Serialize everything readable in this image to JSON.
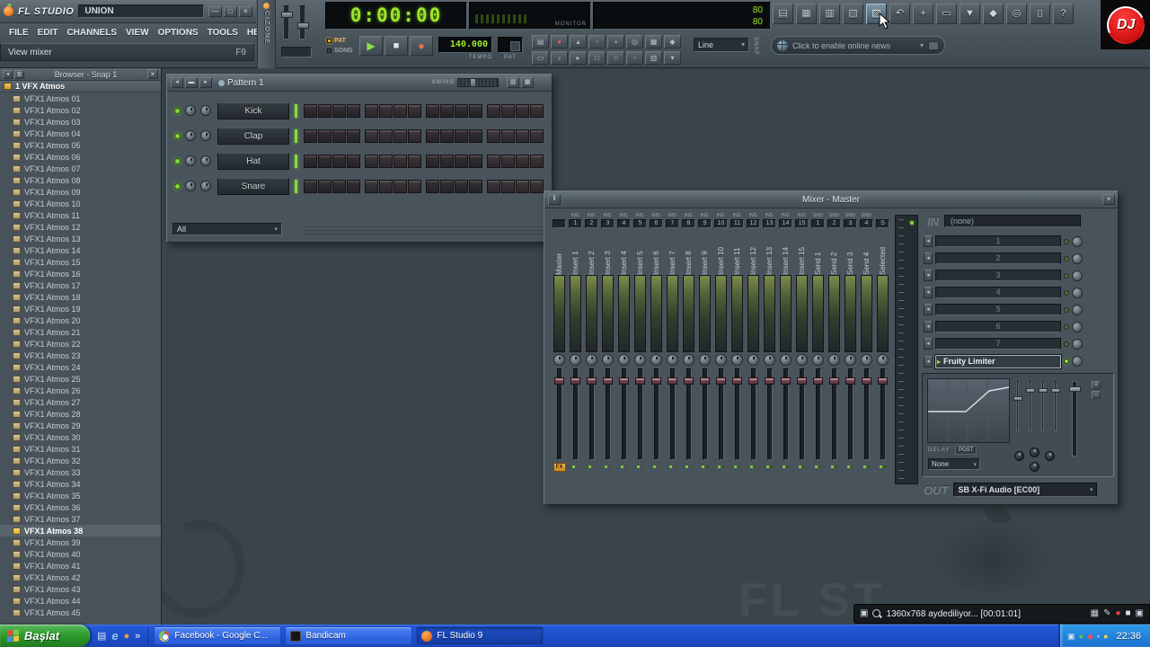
{
  "colors": {
    "lcd_green": "#9de428",
    "desktop": "#3a444b",
    "panel": "#4b565e",
    "taskbar_blue": "#1e4ec8",
    "start_green": "#2f9e2f",
    "record_red": "#e84c40",
    "fx_orange": "#d8942a",
    "dj_red": "#d91616",
    "step_dark": "#332f33",
    "selection": "#ffffff"
  },
  "titlebar": {
    "app": "FL STUDIO",
    "edition": "UNION",
    "window_buttons": [
      {
        "name": "minimize-button",
        "glyph": "—"
      },
      {
        "name": "maximize-button",
        "glyph": "□"
      },
      {
        "name": "close-button",
        "glyph": "×"
      }
    ]
  },
  "menu": {
    "items": [
      "FILE",
      "EDIT",
      "CHANNELS",
      "VIEW",
      "OPTIONS",
      "TOOLS",
      "HELP"
    ]
  },
  "hint": {
    "text": "View mixer",
    "key": "F9"
  },
  "cizone": {
    "label": "CIZONE"
  },
  "transport": {
    "time": "0:00:00",
    "pat_label": "PAT",
    "song_label": "SONG",
    "tempo": "140.000",
    "tempo_label": "TEMPO",
    "pat_lcd_label": "PAT",
    "play_glyph": "▶",
    "stop_glyph": "■",
    "rec_glyph": "●"
  },
  "panels": {
    "monitor_label": "MONITOR",
    "values": [
      "80",
      "80"
    ]
  },
  "mini_row1": [
    {
      "name": "typing-keyboard-icon",
      "glyph": "▤"
    },
    {
      "name": "countdown-icon",
      "glyph": "●",
      "color": "#e06050"
    },
    {
      "name": "metronome-icon",
      "glyph": "▴"
    },
    {
      "name": "wait-input-icon",
      "glyph": "◦"
    },
    {
      "name": "blend-record-icon",
      "glyph": "▪"
    },
    {
      "name": "loop-record-icon",
      "glyph": "◎"
    },
    {
      "name": "step-edit-icon",
      "glyph": "▦"
    },
    {
      "name": "multilink-icon",
      "glyph": "◆"
    }
  ],
  "mini_row2": [
    {
      "name": "overdub-icon",
      "glyph": "▭"
    },
    {
      "name": "note-icon",
      "glyph": "♪"
    },
    {
      "name": "slide-icon",
      "glyph": "▸"
    },
    {
      "name": "mute-icon",
      "glyph": "□"
    },
    {
      "name": "solo-icon",
      "glyph": "○"
    },
    {
      "name": "marker-icon",
      "glyph": "▫"
    },
    {
      "name": "grid-icon",
      "glyph": "▥"
    },
    {
      "name": "menu-icon",
      "glyph": "▾"
    }
  ],
  "snap": {
    "value": "Line",
    "label": "SNAP"
  },
  "news": {
    "text": "Click to enable online news"
  },
  "top_buttons": [
    {
      "name": "playlist-button",
      "glyph": "▤"
    },
    {
      "name": "step-sequencer-button",
      "glyph": "▦"
    },
    {
      "name": "piano-roll-button",
      "glyph": "▥"
    },
    {
      "name": "browser-toggle-button",
      "glyph": "▧"
    },
    {
      "name": "mixer-toggle-button",
      "glyph": "▨",
      "active": true
    },
    {
      "name": "undo-button",
      "glyph": "↶"
    },
    {
      "name": "add-channel-button",
      "glyph": "+"
    },
    {
      "name": "open-button",
      "glyph": "▭"
    },
    {
      "name": "save-button",
      "glyph": "▼"
    },
    {
      "name": "tools-button",
      "glyph": "◆"
    },
    {
      "name": "find-button",
      "glyph": "◎"
    },
    {
      "name": "export-button",
      "glyph": "▯"
    },
    {
      "name": "help-button",
      "glyph": "?"
    }
  ],
  "dj": {
    "text": "DJ"
  },
  "watermark": {
    "text": "FL ST"
  },
  "browser": {
    "title": "Browser - Snap 1",
    "close_glyph": "×",
    "root": "1 VFX Atmos",
    "selected_index": 37,
    "header_icons": [
      {
        "name": "browser-back-icon",
        "glyph": "◂"
      },
      {
        "name": "browser-view-icon",
        "glyph": "▥"
      }
    ],
    "items": [
      "VFX1 Atmos 01",
      "VFX1 Atmos 02",
      "VFX1 Atmos 03",
      "VFX1 Atmos 04",
      "VFX1 Atmos 05",
      "VFX1 Atmos 06",
      "VFX1 Atmos 07",
      "VFX1 Atmos 08",
      "VFX1 Atmos 09",
      "VFX1 Atmos 10",
      "VFX1 Atmos 11",
      "VFX1 Atmos 12",
      "VFX1 Atmos 13",
      "VFX1 Atmos 14",
      "VFX1 Atmos 15",
      "VFX1 Atmos 16",
      "VFX1 Atmos 17",
      "VFX1 Atmos 18",
      "VFX1 Atmos 19",
      "VFX1 Atmos 20",
      "VFX1 Atmos 21",
      "VFX1 Atmos 22",
      "VFX1 Atmos 23",
      "VFX1 Atmos 24",
      "VFX1 Atmos 25",
      "VFX1 Atmos 26",
      "VFX1 Atmos 27",
      "VFX1 Atmos 28",
      "VFX1 Atmos 29",
      "VFX1 Atmos 30",
      "VFX1 Atmos 31",
      "VFX1 Atmos 32",
      "VFX1 Atmos 33",
      "VFX1 Atmos 34",
      "VFX1 Atmos 35",
      "VFX1 Atmos 36",
      "VFX1 Atmos 37",
      "VFX1 Atmos 38",
      "VFX1 Atmos 39",
      "VFX1 Atmos 40",
      "VFX1 Atmos 41",
      "VFX1 Atmos 42",
      "VFX1 Atmos 43",
      "VFX1 Atmos 44",
      "VFX1 Atmos 45"
    ]
  },
  "pattern": {
    "title": "Pattern 1",
    "swing_label": "SWING",
    "filter": "All",
    "steps": 16,
    "nav_buttons": [
      {
        "name": "prev-pattern-button",
        "glyph": "◂"
      },
      {
        "name": "pattern-menu-button",
        "glyph": "▬"
      },
      {
        "name": "next-pattern-button",
        "glyph": "▸"
      }
    ],
    "view_buttons": [
      {
        "name": "graph-editor-button",
        "glyph": "▥"
      },
      {
        "name": "keyboard-editor-button",
        "glyph": "▦"
      }
    ],
    "channels": [
      "Kick",
      "Clap",
      "Hat",
      "Snare"
    ]
  },
  "mixer": {
    "title": "Mixer - Master",
    "close_glyph": "×",
    "corner_glyph": "‖",
    "fx_label": "FX",
    "tracks": [
      {
        "t": "",
        "n": "",
        "name": "Master"
      },
      {
        "t": "INS",
        "n": "1",
        "name": "Insert 1"
      },
      {
        "t": "INS",
        "n": "2",
        "name": "Insert 2"
      },
      {
        "t": "INS",
        "n": "3",
        "name": "Insert 3"
      },
      {
        "t": "INS",
        "n": "4",
        "name": "Insert 4"
      },
      {
        "t": "INS",
        "n": "5",
        "name": "Insert 5"
      },
      {
        "t": "INS",
        "n": "6",
        "name": "Insert 6"
      },
      {
        "t": "INS",
        "n": "7",
        "name": "Insert 7"
      },
      {
        "t": "INS",
        "n": "8",
        "name": "Insert 8"
      },
      {
        "t": "INS",
        "n": "9",
        "name": "Insert 9"
      },
      {
        "t": "INS",
        "n": "10",
        "name": "Insert 10"
      },
      {
        "t": "INS",
        "n": "11",
        "name": "Insert 11"
      },
      {
        "t": "INS",
        "n": "12",
        "name": "Insert 12"
      },
      {
        "t": "INS",
        "n": "13",
        "name": "Insert 13"
      },
      {
        "t": "INS",
        "n": "14",
        "name": "Insert 14"
      },
      {
        "t": "INS",
        "n": "15",
        "name": "Insert 15"
      },
      {
        "t": "SND",
        "n": "1",
        "name": "Send 1"
      },
      {
        "t": "SND",
        "n": "2",
        "name": "Send 2"
      },
      {
        "t": "SND",
        "n": "3",
        "name": "Send 3"
      },
      {
        "t": "SND",
        "n": "4",
        "name": "Send 4"
      },
      {
        "t": "",
        "n": "S",
        "name": "Selected"
      }
    ],
    "rack": {
      "in_label": "IN",
      "in_value": "(none)",
      "slots": [
        "1",
        "2",
        "3",
        "4",
        "5",
        "6",
        "7"
      ],
      "plugin": "Fruity Limiter",
      "delay_label": "DELAY",
      "post_label": "POST",
      "none_value": "None",
      "out_label": "OUT",
      "out_value": "SB X-Fi Audio [EC00]"
    }
  },
  "bandicam": {
    "status": "1360x768 aydediliyor...  [00:01:01]",
    "left_icons": [
      {
        "name": "screen-icon",
        "glyph": "▣",
        "color": "#c8d2da"
      }
    ],
    "right_icons": [
      {
        "name": "capture-target-icon",
        "glyph": "▦",
        "color": "#c8d2da"
      },
      {
        "name": "draw-icon",
        "glyph": "✎",
        "color": "#c8d2da"
      },
      {
        "name": "record-button",
        "glyph": "●",
        "color": "#e84040"
      },
      {
        "name": "stop-button",
        "glyph": "■",
        "color": "#d8e2ea"
      },
      {
        "name": "camera-button",
        "glyph": "▣",
        "color": "#c8d2da"
      }
    ]
  },
  "taskbar": {
    "start_label": "Başlat",
    "overflow": "»",
    "clock": "22:36",
    "flag_colors": [
      "#e84c3c",
      "#7cc84c",
      "#4c8ce8",
      "#f0c83c"
    ],
    "quick": [
      {
        "name": "show-desktop-icon",
        "glyph": "▤",
        "color": "#d8e2f0"
      },
      {
        "name": "ie-icon",
        "glyph": "e",
        "color": "#8cc8f8"
      },
      {
        "name": "browser-ball-icon",
        "glyph": "●",
        "color": "#f0a030"
      }
    ],
    "tasks": [
      {
        "label": "Facebook - Google C...",
        "icon": "chrome"
      },
      {
        "label": "Bandicam",
        "icon": "bandicam"
      },
      {
        "label": "FL Studio 9",
        "icon": "fl",
        "active": true
      }
    ],
    "tray_icons": [
      {
        "name": "tray-display-icon",
        "glyph": "▣",
        "color": "#d8e4f4"
      },
      {
        "name": "tray-shield-icon",
        "glyph": "●",
        "color": "#58c858"
      },
      {
        "name": "tray-alert-icon",
        "glyph": "◆",
        "color": "#e05858"
      },
      {
        "name": "tray-network-icon",
        "glyph": "▪",
        "color": "#a0ccf0"
      },
      {
        "name": "tray-volume-icon",
        "glyph": "●",
        "color": "#f0d050"
      }
    ]
  }
}
